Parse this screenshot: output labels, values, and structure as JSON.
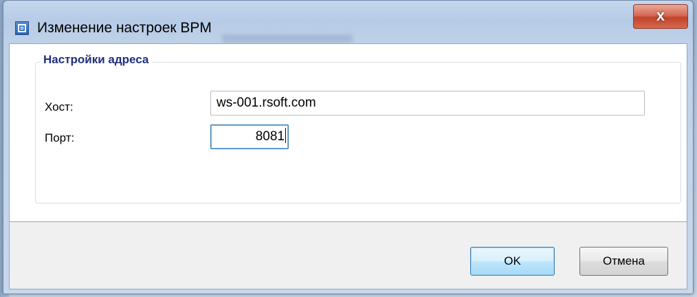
{
  "window": {
    "title": "Изменение настроек BPM",
    "close_label": "x"
  },
  "address_group": {
    "title": "Настройки адреса",
    "host_label": "Хост:",
    "host_value": "ws-001.rsoft.com",
    "port_label": "Порт:",
    "port_value": "8081"
  },
  "buttons": {
    "ok": "OK",
    "cancel": "Отмена"
  },
  "icons": {
    "app": "app-window-icon",
    "close": "close-icon"
  },
  "colors": {
    "group_title": "#1e2f7d",
    "close_button": "#c2432b",
    "default_button_border": "#3c7fb1"
  }
}
